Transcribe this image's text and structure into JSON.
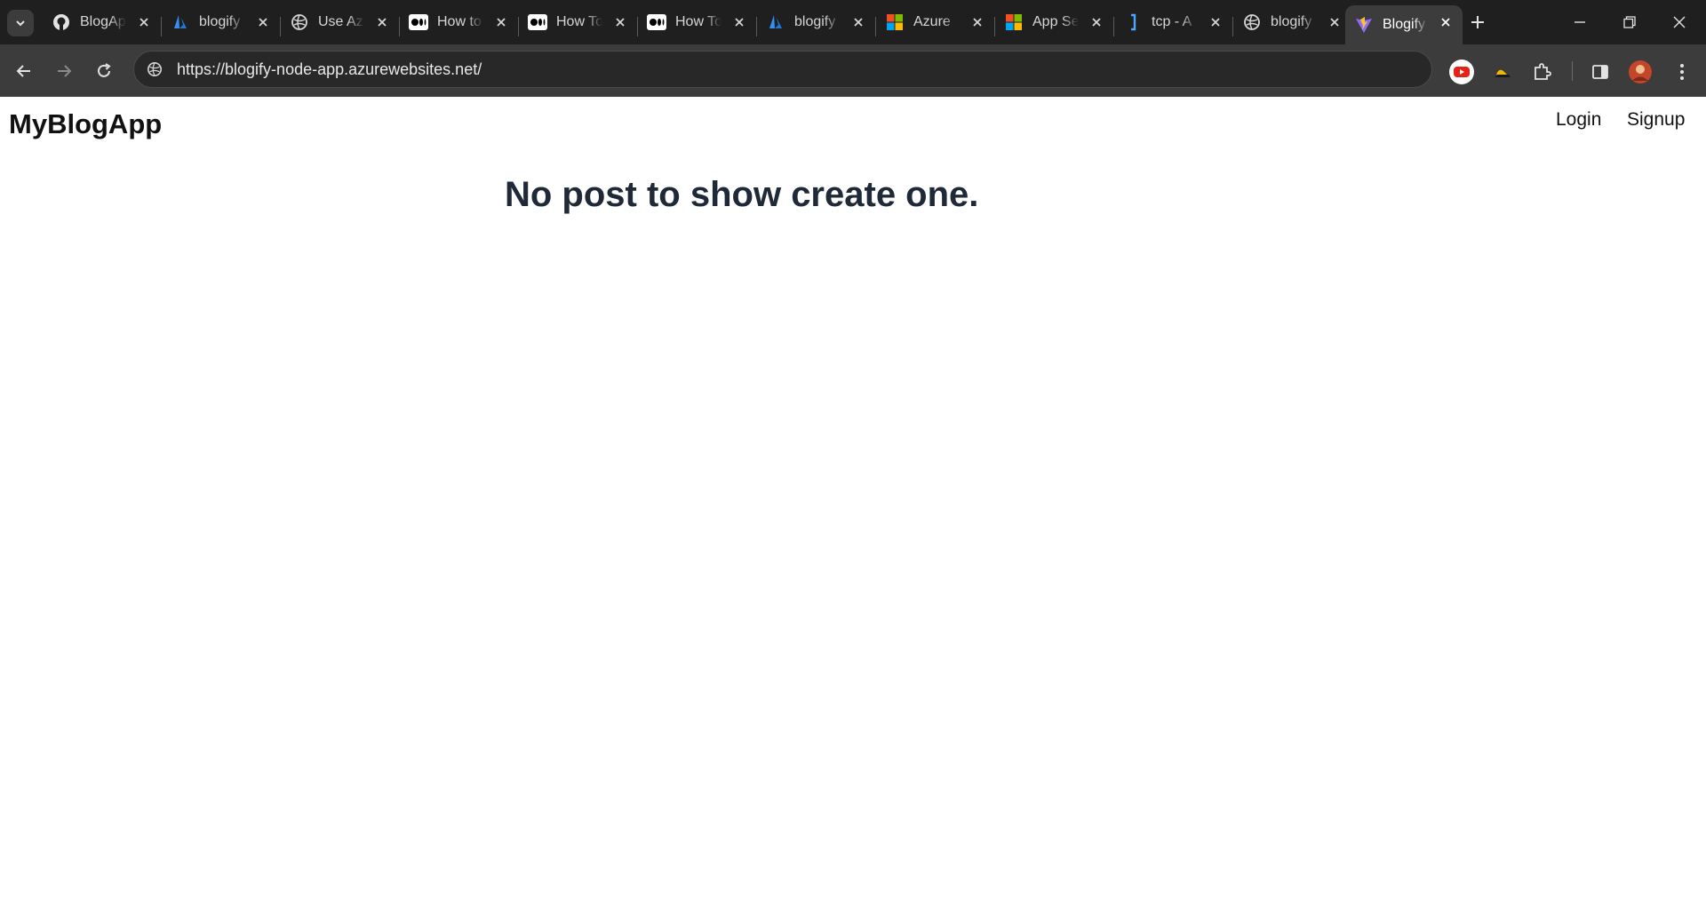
{
  "browser": {
    "tabs": [
      {
        "title": "BlogApp",
        "favicon": "github-icon"
      },
      {
        "title": "blogify",
        "favicon": "azure-icon"
      },
      {
        "title": "Use Azure",
        "favicon": "globe-icon"
      },
      {
        "title": "How to",
        "favicon": "medium-icon"
      },
      {
        "title": "How To",
        "favicon": "medium-icon"
      },
      {
        "title": "How To",
        "favicon": "medium-icon"
      },
      {
        "title": "blogify",
        "favicon": "azure-icon"
      },
      {
        "title": "Azure",
        "favicon": "microsoft-icon"
      },
      {
        "title": "App Se",
        "favicon": "microsoft-icon"
      },
      {
        "title": "tcp - A",
        "favicon": "bracket-icon"
      },
      {
        "title": "blogify",
        "favicon": "globe-icon"
      },
      {
        "title": "Blogify",
        "favicon": "vite-icon",
        "active": true
      }
    ],
    "url": "https://blogify-node-app.azurewebsites.net/",
    "colors": {
      "tabstrip": "#1f1f1f",
      "toolbar": "#3c3c3c",
      "omnibox": "#282828"
    }
  },
  "app": {
    "brand": "MyBlogApp",
    "nav": {
      "login": "Login",
      "signup": "Signup"
    },
    "empty_message": "No post to show create one.",
    "colors": {
      "heading": "#1f2937",
      "text": "#111111"
    }
  }
}
